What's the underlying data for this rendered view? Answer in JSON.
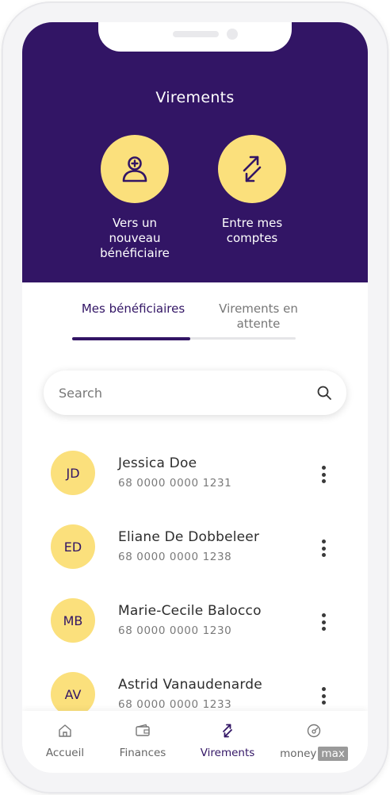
{
  "header": {
    "title": "Virements",
    "actions": [
      {
        "label": "Vers un\nnouveau\nbénéficiaire",
        "icon": "add-user-icon"
      },
      {
        "label": "Entre mes\ncomptes",
        "icon": "transfer-arrows-icon"
      }
    ]
  },
  "tabs": [
    {
      "label": "Mes bénéficiaires",
      "active": true
    },
    {
      "label": "Virements en\nattente",
      "active": false
    }
  ],
  "search": {
    "placeholder": "Search",
    "value": ""
  },
  "beneficiaries": [
    {
      "initials": "JD",
      "name": "Jessica Doe",
      "account": "68 0000 0000 1231"
    },
    {
      "initials": "ED",
      "name": "Eliane De Dobbeleer",
      "account": "68 0000 0000 1238"
    },
    {
      "initials": "MB",
      "name": "Marie-Cecile Balocco",
      "account": "68 0000 0000 1230"
    },
    {
      "initials": "AV",
      "name": "Astrid Vanaudenarde",
      "account": "68 0000 0000 1233"
    }
  ],
  "bottom_nav": {
    "items": [
      {
        "label": "Accueil",
        "icon": "home-icon"
      },
      {
        "label": "Finances",
        "icon": "wallet-icon"
      },
      {
        "label": "Virements",
        "icon": "transfer-icon",
        "active": true
      },
      {
        "label_main": "money",
        "label_box": "max",
        "icon": "gauge-icon"
      }
    ]
  },
  "colors": {
    "brand": "#321565",
    "accent": "#fbe07c",
    "text": "#2d2d2d",
    "muted": "#7a7a7a"
  }
}
